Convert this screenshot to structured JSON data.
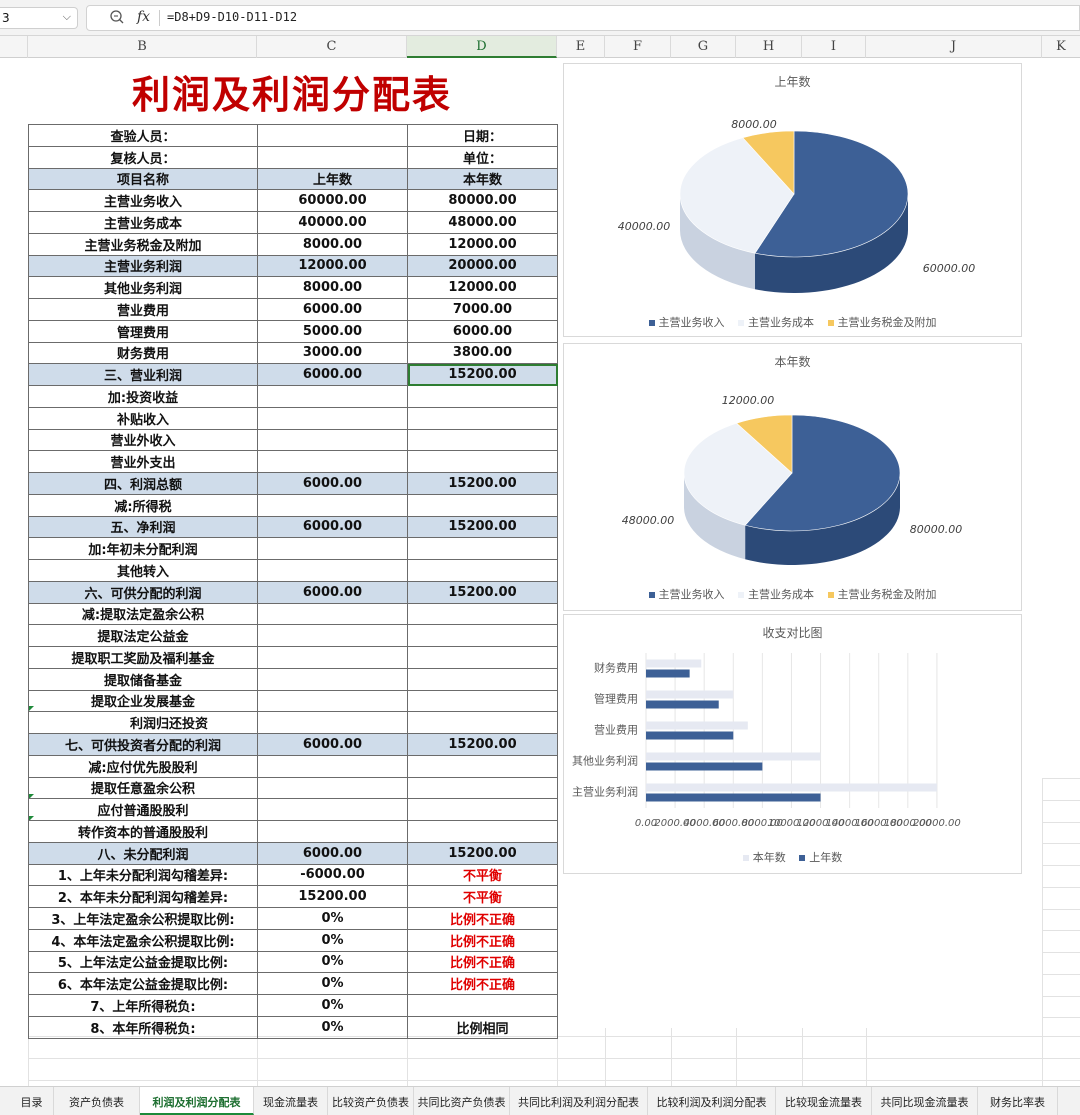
{
  "formula_bar": {
    "cell_ref": "3",
    "fx_label": "fx",
    "formula": "=D8+D9-D10-D11-D12"
  },
  "columns": [
    "B",
    "C",
    "D",
    "E",
    "F",
    "G",
    "H",
    "I",
    "J",
    "K"
  ],
  "sheet": {
    "title": "利润及利润分配表",
    "rows": [
      {
        "name": "查验人员：",
        "c": "",
        "d": "日期：",
        "hl": false
      },
      {
        "name": "复核人员：",
        "c": "",
        "d": "单位：",
        "hl": false
      },
      {
        "name": "项目名称",
        "c": "上年数",
        "d": "本年数",
        "hl": true
      },
      {
        "name": "主营业务收入",
        "c": "60000.00",
        "d": "80000.00",
        "hl": false
      },
      {
        "name": "主营业务成本",
        "c": "40000.00",
        "d": "48000.00",
        "hl": false
      },
      {
        "name": "主营业务税金及附加",
        "c": "8000.00",
        "d": "12000.00",
        "hl": false
      },
      {
        "name": "主营业务利润",
        "c": "12000.00",
        "d": "20000.00",
        "hl": true
      },
      {
        "name": "其他业务利润",
        "c": "8000.00",
        "d": "12000.00",
        "hl": false
      },
      {
        "name": "营业费用",
        "c": "6000.00",
        "d": "7000.00",
        "hl": false
      },
      {
        "name": "管理费用",
        "c": "5000.00",
        "d": "6000.00",
        "hl": false
      },
      {
        "name": "财务费用",
        "c": "3000.00",
        "d": "3800.00",
        "hl": false
      },
      {
        "name": "三、营业利润",
        "c": "6000.00",
        "d": "15200.00",
        "hl": true,
        "selected": true
      },
      {
        "name": "加:投资收益",
        "c": "",
        "d": "",
        "hl": false
      },
      {
        "name": "补贴收入",
        "c": "",
        "d": "",
        "hl": false
      },
      {
        "name": "营业外收入",
        "c": "",
        "d": "",
        "hl": false
      },
      {
        "name": "营业外支出",
        "c": "",
        "d": "",
        "hl": false
      },
      {
        "name": "四、利润总额",
        "c": "6000.00",
        "d": "15200.00",
        "hl": true
      },
      {
        "name": "减:所得税",
        "c": "",
        "d": "",
        "hl": false
      },
      {
        "name": "五、净利润",
        "c": "6000.00",
        "d": "15200.00",
        "hl": true
      },
      {
        "name": "加:年初未分配利润",
        "c": "",
        "d": "",
        "hl": false
      },
      {
        "name": "其他转入",
        "c": "",
        "d": "",
        "hl": false
      },
      {
        "name": "六、可供分配的利润",
        "c": "6000.00",
        "d": "15200.00",
        "hl": true
      },
      {
        "name": "减:提取法定盈余公积",
        "c": "",
        "d": "",
        "hl": false
      },
      {
        "name": "提取法定公益金",
        "c": "",
        "d": "",
        "hl": false
      },
      {
        "name": "提取职工奖励及福利基金",
        "c": "",
        "d": "",
        "hl": false
      },
      {
        "name": "提取储备基金",
        "c": "",
        "d": "",
        "hl": false
      },
      {
        "name": "提取企业发展基金",
        "c": "",
        "d": "",
        "hl": false
      },
      {
        "name": "利润归还投资",
        "c": "",
        "d": "",
        "hl": false,
        "indent": true
      },
      {
        "name": "七、可供投资者分配的利润",
        "c": "6000.00",
        "d": "15200.00",
        "hl": true
      },
      {
        "name": "减:应付优先股股利",
        "c": "",
        "d": "",
        "hl": false
      },
      {
        "name": "提取任意盈余公积",
        "c": "",
        "d": "",
        "hl": false
      },
      {
        "name": "应付普通股股利",
        "c": "",
        "d": "",
        "hl": false
      },
      {
        "name": "转作资本的普通股股利",
        "c": "",
        "d": "",
        "hl": false
      },
      {
        "name": "八、未分配利润",
        "c": "6000.00",
        "d": "15200.00",
        "hl": true
      },
      {
        "name": "1、上年未分配利润勾稽差异:",
        "c": "-6000.00",
        "d": "不平衡",
        "hl": false,
        "red": true
      },
      {
        "name": "2、本年未分配利润勾稽差异:",
        "c": "15200.00",
        "d": "不平衡",
        "hl": false,
        "red": true
      },
      {
        "name": "3、上年法定盈余公积提取比例:",
        "c": "0%",
        "d": "比例不正确",
        "hl": false,
        "red": true
      },
      {
        "name": "4、本年法定盈余公积提取比例:",
        "c": "0%",
        "d": "比例不正确",
        "hl": false,
        "red": true
      },
      {
        "name": "5、上年法定公益金提取比例:",
        "c": "0%",
        "d": "比例不正确",
        "hl": false,
        "red": true
      },
      {
        "name": "6、本年法定公益金提取比例:",
        "c": "0%",
        "d": "比例不正确",
        "hl": false,
        "red": true
      },
      {
        "name": "7、上年所得税负:",
        "c": "0%",
        "d": "",
        "hl": false
      },
      {
        "name": "8、本年所得税负:",
        "c": "0%",
        "d": "比例相同",
        "hl": false
      }
    ]
  },
  "chart_data": [
    {
      "type": "pie",
      "title": "上年数",
      "categories": [
        "主营业务收入",
        "主营业务成本",
        "主营业务税金及附加"
      ],
      "values": [
        60000,
        40000,
        8000
      ],
      "labels": [
        "60000.00",
        "40000.00",
        "8000.00"
      ],
      "colors": [
        "#3d6096",
        "#eef2f8",
        "#f6c85f"
      ],
      "legend": "bottom"
    },
    {
      "type": "pie",
      "title": "本年数",
      "categories": [
        "主营业务收入",
        "主营业务成本",
        "主营业务税金及附加"
      ],
      "values": [
        80000,
        48000,
        12000
      ],
      "labels": [
        "80000.00",
        "48000.00",
        "12000.00"
      ],
      "colors": [
        "#3d6096",
        "#eef2f8",
        "#f6c85f"
      ],
      "legend": "bottom"
    },
    {
      "type": "bar",
      "orientation": "horizontal",
      "title": "收支对比图",
      "categories": [
        "主营业务利润",
        "其他业务利润",
        "营业费用",
        "管理费用",
        "财务费用"
      ],
      "series": [
        {
          "name": "本年数",
          "values": [
            20000,
            12000,
            7000,
            6000,
            3800
          ],
          "color": "#e6e9f2"
        },
        {
          "name": "上年数",
          "values": [
            12000,
            8000,
            6000,
            5000,
            3000
          ],
          "color": "#3d6096"
        }
      ],
      "xlim": [
        0,
        22000
      ],
      "xticks": [
        "0.00",
        "2000.00",
        "4000.00",
        "6000.00",
        "8000.00",
        "10000.00",
        "12000.00",
        "14000.00",
        "16000.00",
        "18000.00",
        "20000.00"
      ],
      "grid": true,
      "legend": "bottom"
    }
  ],
  "tabs": [
    {
      "label": "目录",
      "active": false
    },
    {
      "label": "资产负债表",
      "active": false
    },
    {
      "label": "利润及利润分配表",
      "active": true
    },
    {
      "label": "现金流量表",
      "active": false
    },
    {
      "label": "比较资产负债表",
      "active": false
    },
    {
      "label": "共同比资产负债表",
      "active": false
    },
    {
      "label": "共同比利润及利润分配表",
      "active": false
    },
    {
      "label": "比较利润及利润分配表",
      "active": false
    },
    {
      "label": "比较现金流量表",
      "active": false
    },
    {
      "label": "共同比现金流量表",
      "active": false
    },
    {
      "label": "财务比率表",
      "active": false
    }
  ]
}
